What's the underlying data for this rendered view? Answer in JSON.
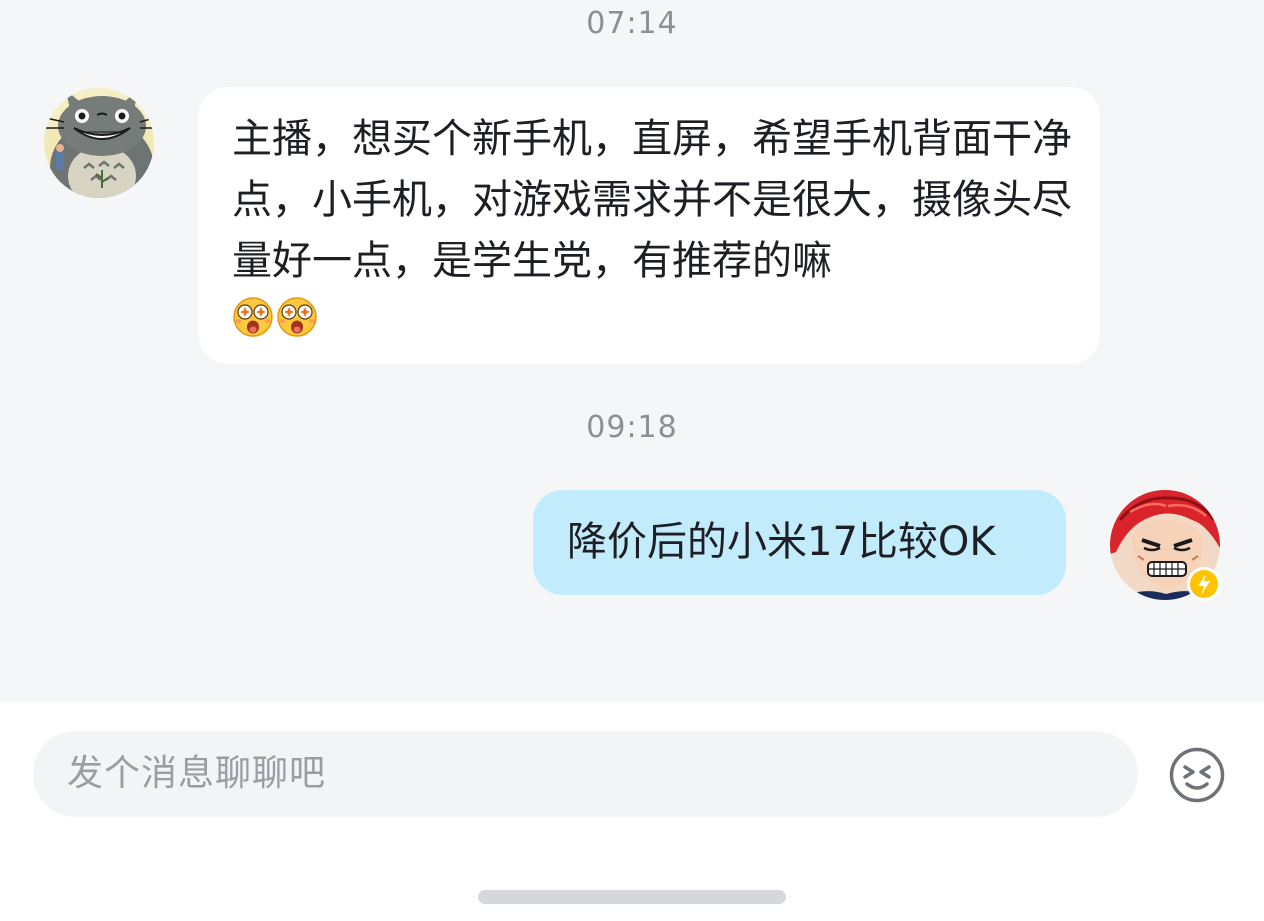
{
  "messages": [
    {
      "timestamp": "07:14",
      "sender": "other",
      "text": "主播，想买个新手机，直屏，希望手机背面干净点，小手机，对游戏需求并不是很大，摄像头尽量好一点，是学生党，有推荐的嘛",
      "emojis": [
        "amazed-face-emoji",
        "amazed-face-emoji"
      ]
    },
    {
      "timestamp": "09:18",
      "sender": "self",
      "text": "降价后的小米17比较OK"
    }
  ],
  "input": {
    "placeholder": "发个消息聊聊吧"
  },
  "icons": {
    "emoji_button": "smiley-face-icon",
    "self_avatar_badge": "lightning-badge-icon"
  },
  "colors": {
    "chat_background": "#f5f6f8",
    "incoming_bubble": "#ffffff",
    "outgoing_bubble": "#c2ecfb",
    "timestamp_text": "#8c8f96",
    "badge": "#ffc400"
  }
}
